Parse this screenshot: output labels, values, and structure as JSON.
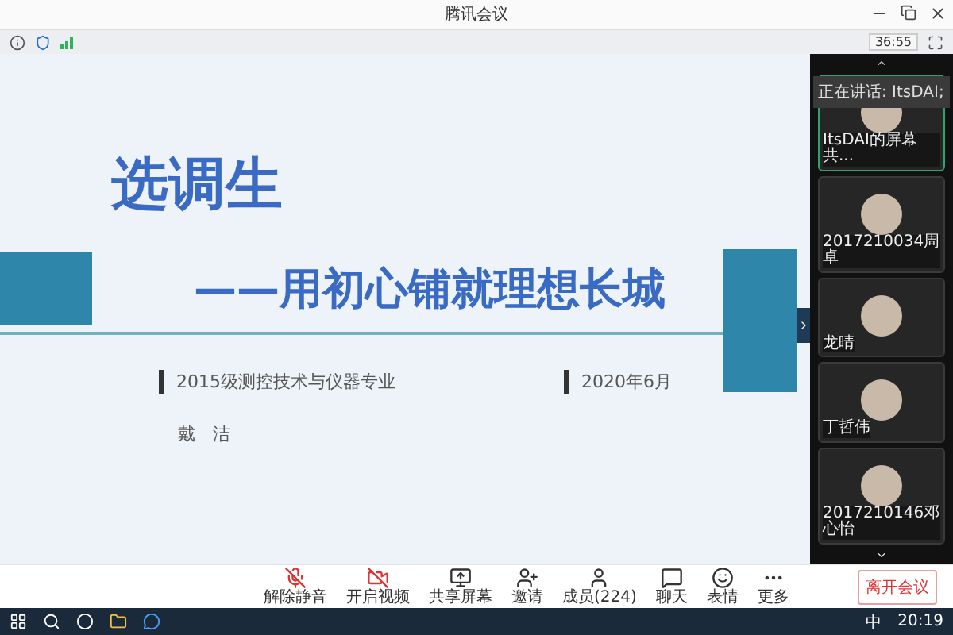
{
  "window": {
    "title": "腾讯会议"
  },
  "info_bar": {
    "timer": "36:55"
  },
  "slide": {
    "title": "选调生",
    "subtitle": "——用初心铺就理想长城",
    "major": "2015级测控技术与仪器专业",
    "date": "2020年6月",
    "author": "戴　洁"
  },
  "speaker_panel": {
    "speaking": "正在讲话: ItsDAI;",
    "tiles": [
      {
        "name": "ItsDAI的屏幕共...",
        "speaking": true
      },
      {
        "name": "2017210034周卓",
        "speaking": false
      },
      {
        "name": "龙晴",
        "speaking": false
      },
      {
        "name": "丁哲伟",
        "speaking": false
      },
      {
        "name": "2017210146邓心怡",
        "speaking": false
      }
    ]
  },
  "toolbar": {
    "buttons": [
      {
        "kind": "mic",
        "label": "解除静音",
        "muted": true
      },
      {
        "kind": "video",
        "label": "开启视频",
        "muted": true
      },
      {
        "kind": "share",
        "label": "共享屏幕"
      },
      {
        "kind": "invite",
        "label": "邀请"
      },
      {
        "kind": "members",
        "label": "成员(224)"
      },
      {
        "kind": "chat",
        "label": "聊天"
      },
      {
        "kind": "emoji",
        "label": "表情"
      },
      {
        "kind": "more",
        "label": "更多"
      }
    ],
    "leave": "离开会议"
  },
  "taskbar": {
    "ime": "中",
    "time": "20:19"
  }
}
